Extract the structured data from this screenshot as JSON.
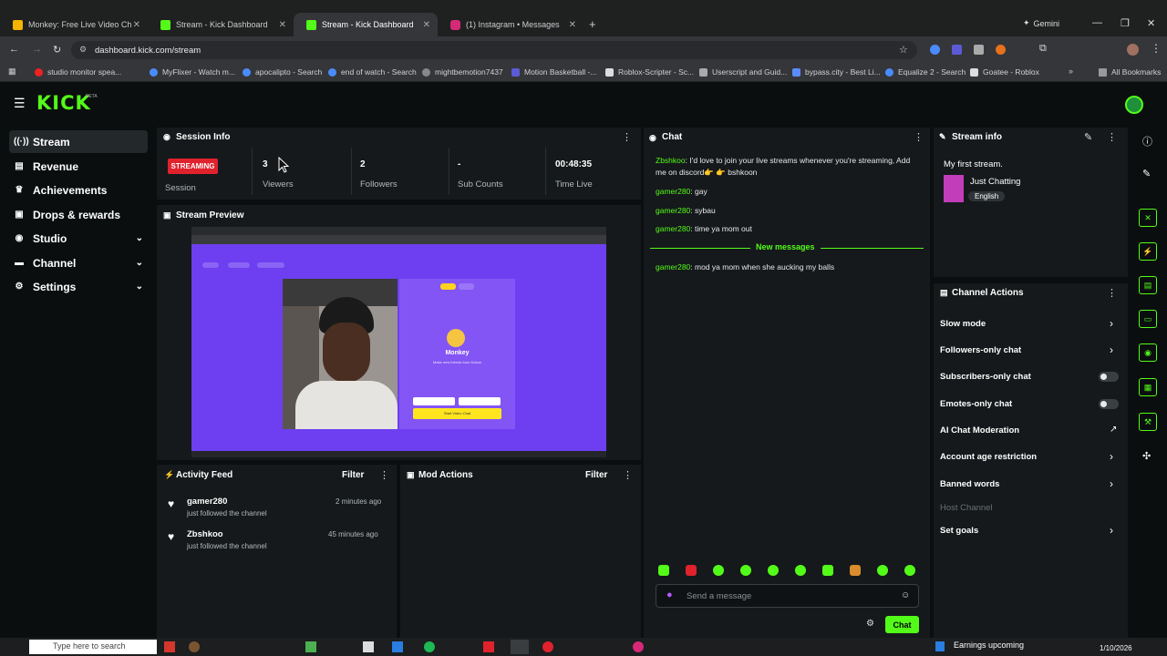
{
  "browser": {
    "tabs": [
      {
        "label": "Monkey: Free Live Video Ch",
        "active": false
      },
      {
        "label": "Stream - Kick Dashboard",
        "active": false
      },
      {
        "label": "Stream - Kick Dashboard",
        "active": true
      },
      {
        "label": "(1) Instagram • Messages",
        "active": false
      }
    ],
    "gemini": "Gemini",
    "url": "dashboard.kick.com/stream",
    "bookmarks": [
      "studio monitor spea...",
      "MyFlixer - Watch m...",
      "apocalipto - Search",
      "end of watch - Search",
      "mightbemotion7437",
      "Motion Basketball -...",
      "Roblox-Scripter - Sc...",
      "Userscript and Guid...",
      "bypass.city - Best Li...",
      "Equalize 2 - Search",
      "Goatee - Roblox"
    ],
    "all_bookmarks": "All Bookmarks"
  },
  "brand": {
    "logo": "KICK",
    "beta": "BETA"
  },
  "sidebar": [
    {
      "label": "Stream",
      "icon": "broadcast-icon"
    },
    {
      "label": "Revenue",
      "icon": "revenue-icon"
    },
    {
      "label": "Achievements",
      "icon": "trophy-icon"
    },
    {
      "label": "Drops & rewards",
      "icon": "gift-icon"
    },
    {
      "label": "Studio",
      "icon": "studio-icon"
    },
    {
      "label": "Channel",
      "icon": "channel-icon"
    },
    {
      "label": "Settings",
      "icon": "gear-icon"
    }
  ],
  "session": {
    "title": "Session Info",
    "badge": "STREAMING",
    "badge_label": "Session",
    "viewers_value": "3",
    "viewers_label": "Viewers",
    "followers_value": "2",
    "followers_label": "Followers",
    "subs_value": "-",
    "subs_label": "Sub Counts",
    "time_value": "00:48:35",
    "time_label": "Time Live"
  },
  "preview": {
    "title": "Stream Preview",
    "monkey_title": "Monkey",
    "monkey_sub": "Make new friends from Kokan",
    "monkey_btn": "Start Video Chat"
  },
  "activity": {
    "title": "Activity Feed",
    "filter": "Filter",
    "items": [
      {
        "user": "gamer280",
        "action": "just followed the channel",
        "time": "2 minutes ago"
      },
      {
        "user": "Zbshkoo",
        "action": "just followed the channel",
        "time": "45 minutes ago"
      }
    ]
  },
  "mod": {
    "title": "Mod Actions",
    "filter": "Filter"
  },
  "chat": {
    "title": "Chat",
    "messages": [
      {
        "user": "Zbshkoo",
        "text": "I'd love to join your live streams whenever you're streaming, Add me on discord👉 👉 bshkoon"
      },
      {
        "user": "gamer280",
        "text": "gay"
      },
      {
        "user": "gamer280",
        "text": "sybau"
      },
      {
        "user": "gamer280",
        "text": "time ya mom out"
      },
      {
        "user": "gamer280",
        "text": "mod ya mom when she aucking my balls"
      }
    ],
    "new_messages": "New messages",
    "placeholder": "Send a message",
    "send": "Chat"
  },
  "stream_info": {
    "title": "Stream info",
    "stream_title": "My first stream.",
    "category": "Just Chatting",
    "tag": "English"
  },
  "channel_actions": {
    "title": "Channel Actions",
    "items": [
      {
        "label": "Slow mode",
        "control": "arrow"
      },
      {
        "label": "Followers-only chat",
        "control": "arrow"
      },
      {
        "label": "Subscribers-only chat",
        "control": "toggle"
      },
      {
        "label": "Emotes-only chat",
        "control": "toggle"
      },
      {
        "label": "AI Chat Moderation",
        "control": "external"
      },
      {
        "label": "Account age restriction",
        "control": "arrow"
      },
      {
        "label": "Banned words",
        "control": "arrow"
      },
      {
        "label": "Host Channel",
        "control": "disabled"
      },
      {
        "label": "Set goals",
        "control": "arrow"
      }
    ]
  },
  "taskbar": {
    "search": "Type here to search",
    "status": "Earnings upcoming",
    "date": "1/10/2026"
  },
  "colors": {
    "accent": "#53fc18",
    "streaming": "#e0222d",
    "bg": "#0b0e0f",
    "panel": "#15191b",
    "preview_purple": "#7c3aed"
  }
}
